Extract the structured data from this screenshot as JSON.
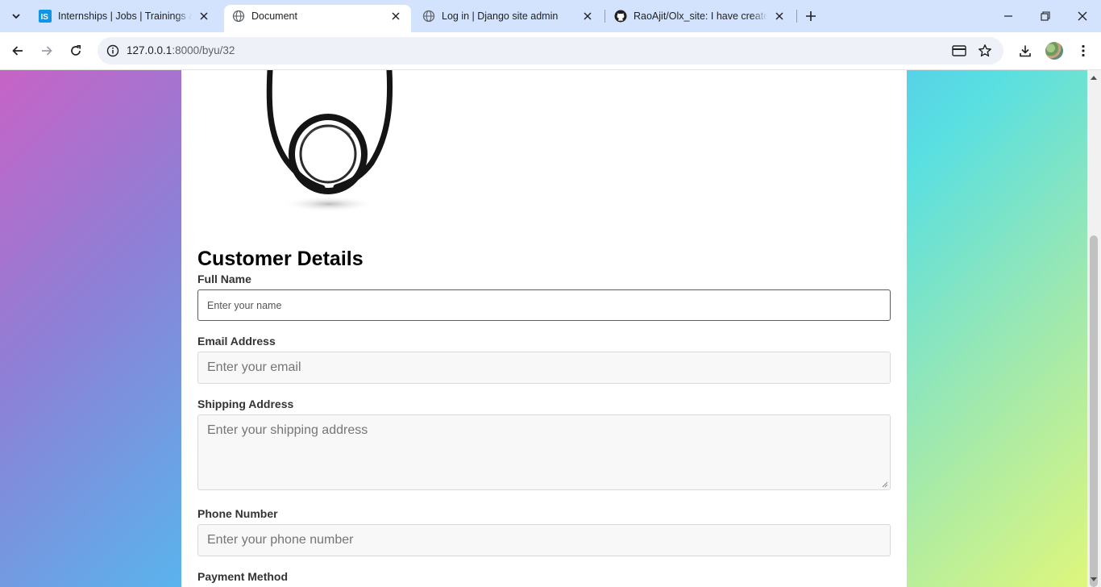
{
  "browser": {
    "tabs": [
      {
        "title": "Internships | Jobs | Trainings & Courses",
        "favicon": "internshala-icon",
        "active": false
      },
      {
        "title": "Document",
        "favicon": "globe-icon",
        "active": true
      },
      {
        "title": "Log in | Django site admin",
        "favicon": "globe-icon",
        "active": false
      },
      {
        "title": "RaoAjit/Olx_site: I have created this",
        "favicon": "github-icon",
        "active": false
      }
    ],
    "url_host": "127.0.0.1",
    "url_path": ":8000/byu/32",
    "colors": {
      "tabstrip": "#d3e3fd",
      "omnibox": "#eef1f8"
    }
  },
  "page": {
    "section_title": "Customer Details",
    "fields": {
      "full_name": {
        "label": "Full Name",
        "placeholder": "Enter your name"
      },
      "email": {
        "label": "Email Address",
        "placeholder": "Enter your email"
      },
      "shipping": {
        "label": "Shipping Address",
        "placeholder": "Enter your shipping address"
      },
      "phone": {
        "label": "Phone Number",
        "placeholder": "Enter your phone number"
      },
      "payment": {
        "label": "Payment Method"
      }
    },
    "colors": {
      "gradient_start": "#c763c6",
      "gradient_mid": "#55b8ef",
      "gradient_end": "#e2f77a"
    }
  }
}
